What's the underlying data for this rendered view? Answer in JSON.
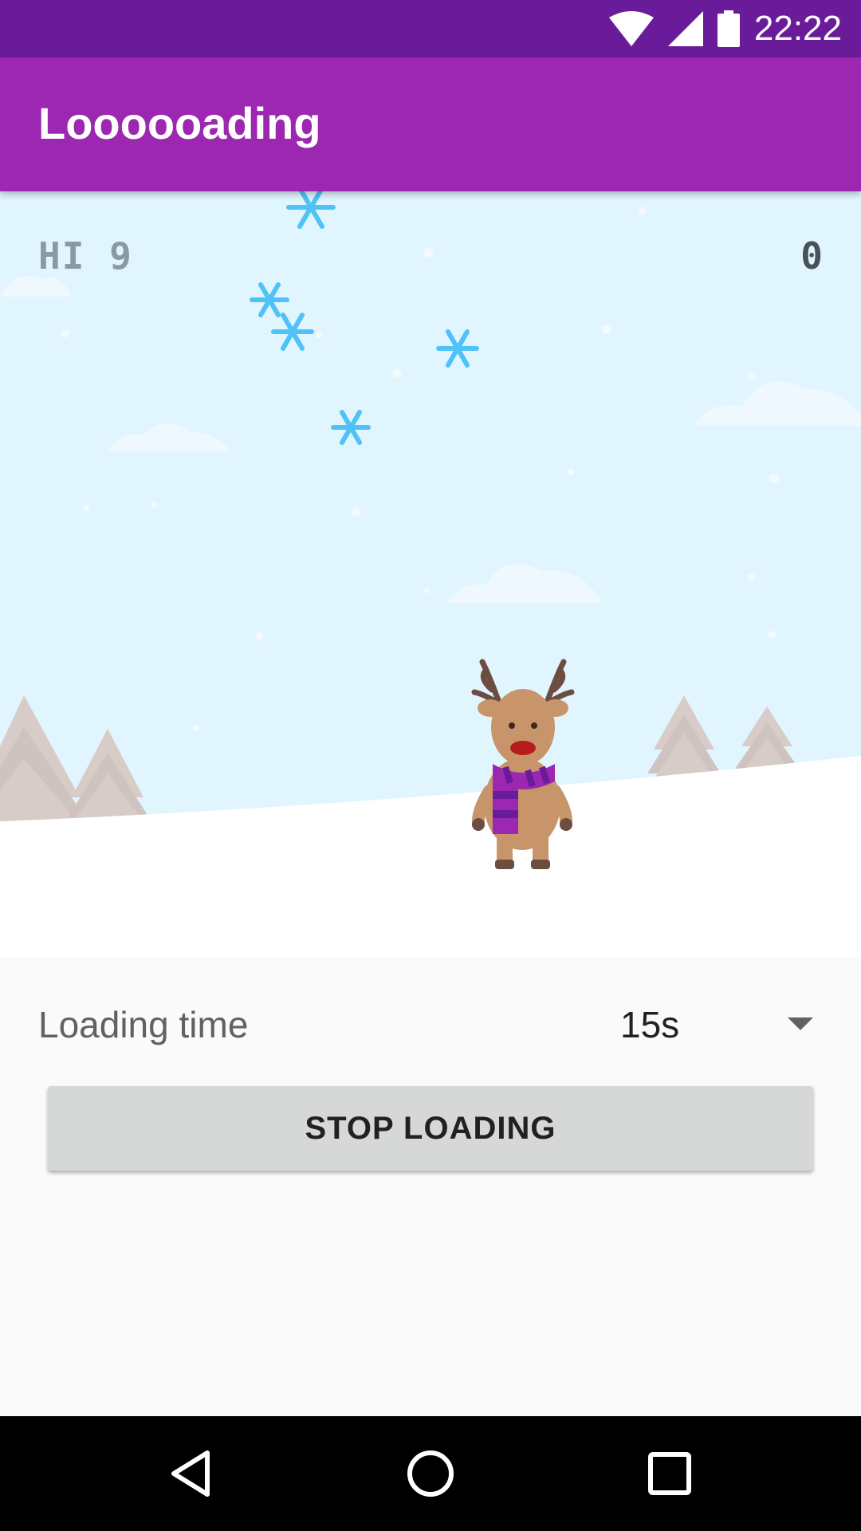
{
  "status_bar": {
    "time": "22:22",
    "icons": [
      "wifi-icon",
      "cell-signal-icon",
      "battery-icon"
    ]
  },
  "app_bar": {
    "title": "Loooooading"
  },
  "game": {
    "hi_score": "HI 9",
    "score": "0"
  },
  "settings": {
    "loading_label": "Loading time",
    "loading_time_value": "15s"
  },
  "actions": {
    "stop_label": "STOP LOADING"
  },
  "nav_bar": {
    "icons": [
      "back-icon",
      "home-icon",
      "recents-icon"
    ]
  },
  "colors": {
    "status_bar": "#6a1b9a",
    "app_bar": "#9c27b0",
    "sky": "#e1f5fe",
    "snowflake": "#4fc3f7",
    "scarf": "#9c27b0"
  }
}
